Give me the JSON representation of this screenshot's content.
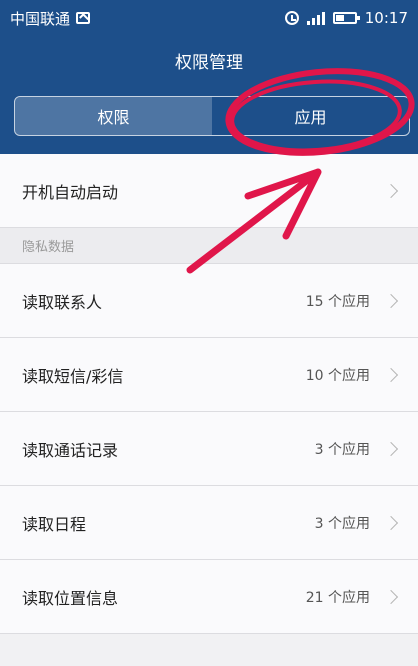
{
  "status_bar": {
    "carrier": "中国联通",
    "time": "10:17",
    "icons": [
      "image-icon",
      "alarm-clock-icon",
      "signal-icon",
      "battery-icon"
    ]
  },
  "header": {
    "title": "权限管理",
    "tabs": [
      {
        "label": "权限",
        "active": true
      },
      {
        "label": "应用",
        "active": false
      }
    ]
  },
  "list": {
    "autostart": {
      "label": "开机自动启动"
    },
    "section_label": "隐私数据",
    "items": [
      {
        "label": "读取联系人",
        "count": "15 个应用"
      },
      {
        "label": "读取短信/彩信",
        "count": "10 个应用"
      },
      {
        "label": "读取通话记录",
        "count": "3 个应用"
      },
      {
        "label": "读取日程",
        "count": "3 个应用"
      },
      {
        "label": "读取位置信息",
        "count": "21 个应用"
      }
    ]
  },
  "colors": {
    "header_bg": "#1d4f8a",
    "annotation": "#e0164a"
  }
}
